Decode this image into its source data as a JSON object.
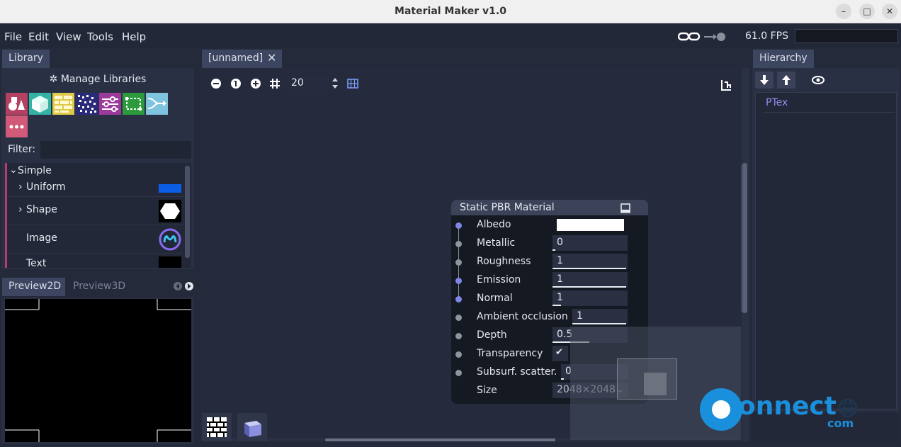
{
  "window": {
    "title": "Material Maker v1.0"
  },
  "menu": [
    "File",
    "Edit",
    "View",
    "Tools",
    "Help"
  ],
  "status": {
    "fps": "61.0 FPS"
  },
  "library": {
    "tab": "Library",
    "manage_label": "Manage Libraries",
    "filter_label": "Filter:",
    "filter_value": "",
    "icons": [
      "shapes-icon",
      "cube-icon",
      "brick-icon",
      "noise-icon",
      "sliders-icon",
      "selection-icon",
      "merge-icon",
      "more-icon"
    ],
    "category": "Simple",
    "items": [
      {
        "label": "Uniform",
        "expandable": true,
        "swatch": "#0a5fe6"
      },
      {
        "label": "Shape",
        "expandable": true,
        "swatch": "hexagon"
      },
      {
        "label": "Image",
        "expandable": false,
        "swatch": "logo"
      },
      {
        "label": "Text",
        "expandable": false,
        "swatch": "text"
      }
    ]
  },
  "preview": {
    "tabs": [
      "Preview2D",
      "Preview3D"
    ]
  },
  "graph": {
    "tab_label": "[unnamed]",
    "zoom_value": "20",
    "node": {
      "title": "Static PBR Material",
      "params": [
        {
          "name": "Albedo",
          "value": "",
          "port": "blue",
          "kind": "color"
        },
        {
          "name": "Metallic",
          "value": "0",
          "port": "grey",
          "kind": "slider",
          "fill": 0
        },
        {
          "name": "Roughness",
          "value": "1",
          "port": "grey",
          "kind": "slider",
          "fill": 1
        },
        {
          "name": "Emission",
          "value": "1",
          "port": "blue",
          "kind": "slider",
          "fill": 1
        },
        {
          "name": "Normal",
          "value": "1",
          "port": "blue",
          "kind": "slider",
          "fill": 0.1
        },
        {
          "name": "Ambient occlusion",
          "value": "1",
          "port": "grey",
          "kind": "slider",
          "fill": 1
        },
        {
          "name": "Depth",
          "value": "0.5",
          "port": "grey",
          "kind": "slider",
          "fill": 0.5
        },
        {
          "name": "Transparency",
          "value": "✔",
          "port": "grey",
          "kind": "checkbox"
        },
        {
          "name": "Subsurf. scatter.",
          "value": "0",
          "port": "grey",
          "kind": "slider",
          "fill": 0
        },
        {
          "name": "Size",
          "value": "2048×2048",
          "port": "none",
          "kind": "select"
        }
      ]
    }
  },
  "hierarchy": {
    "tab": "Hierarchy",
    "items": [
      "PTex"
    ]
  },
  "watermark": {
    "text_main": "onnect",
    "text_sub": "com"
  },
  "colors": {
    "accent": "#7f86e6",
    "tree_accent": "#b43c6e",
    "panel": "#2a3044",
    "graph_bg": "#252b3c"
  }
}
